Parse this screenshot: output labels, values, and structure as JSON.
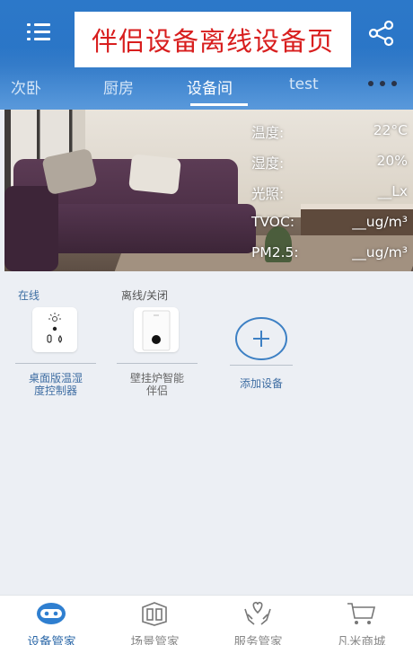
{
  "header": {
    "title": "伴侣设备离线设备页"
  },
  "tabs": [
    {
      "label": "次卧"
    },
    {
      "label": "厨房"
    },
    {
      "label": "设备间"
    },
    {
      "label": "test"
    }
  ],
  "active_tab": "设备间",
  "readings": [
    {
      "label": "温度:",
      "value": "22°C"
    },
    {
      "label": "湿度:",
      "value": "20%"
    },
    {
      "label": "光照:",
      "value": "__Lx"
    },
    {
      "label": "TVOC:",
      "value": "__ug/m³"
    },
    {
      "label": "PM2.5:",
      "value": "__ug/m³"
    }
  ],
  "devices": {
    "status_online": "在线",
    "status_offline": "离线/关闭",
    "items": [
      {
        "name_line1": "桌面版温湿",
        "name_line2": "度控制器"
      },
      {
        "name_line1": "壁挂炉智能",
        "name_line2": "伴侣"
      }
    ],
    "add_label": "添加设备"
  },
  "bottom_nav": [
    {
      "label": "设备管家",
      "icon": "robot-icon"
    },
    {
      "label": "场景管家",
      "icon": "scene-box-icon"
    },
    {
      "label": "服务管家",
      "icon": "heart-hands-icon"
    },
    {
      "label": "凡米商城",
      "icon": "cart-icon"
    }
  ],
  "colors": {
    "header_blue": "#2c78c9",
    "title_red": "#d81e1e",
    "accent_blue": "#2c68a8"
  }
}
